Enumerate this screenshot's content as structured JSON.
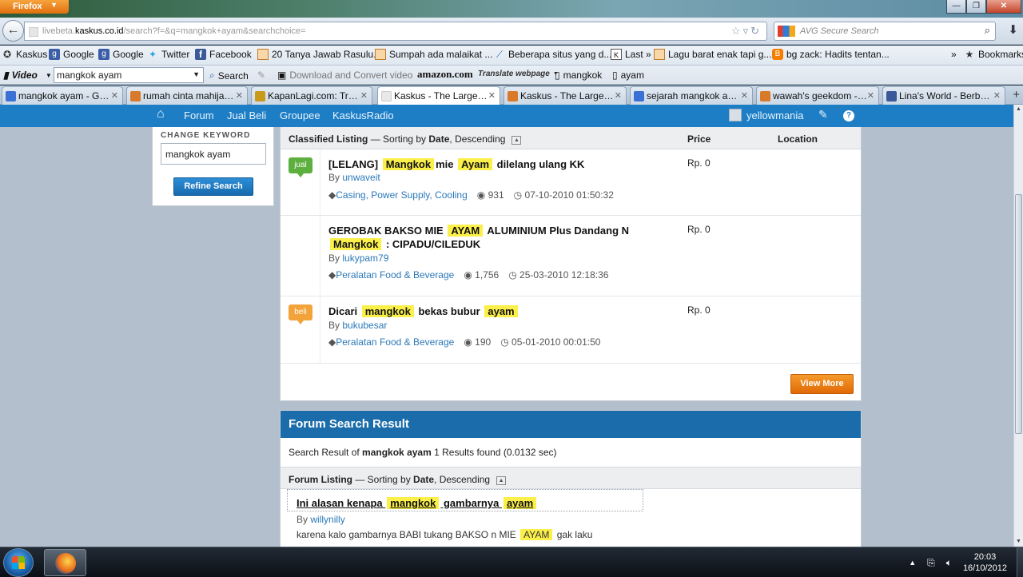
{
  "window": {
    "menu_label": "Firefox",
    "minimize": "—",
    "maximize": "❐",
    "close": "✕"
  },
  "nav": {
    "url_prefix": "livebeta.",
    "url_host": "kaskus.co.id",
    "url_rest": "/search?f=&q=mangkok+ayam&searchchoice=",
    "search_placeholder": "AVG Secure Search"
  },
  "bookmarks": [
    {
      "label": "Kaskus",
      "icon": "star-icon"
    },
    {
      "label": "Google",
      "icon": "google-icon"
    },
    {
      "label": "Google",
      "icon": "google-icon"
    },
    {
      "label": "Twitter",
      "icon": "twitter-icon"
    },
    {
      "label": "Facebook",
      "icon": "facebook-icon"
    },
    {
      "label": "20 Tanya Jawab Rasulu...",
      "icon": "page-icon"
    },
    {
      "label": "Sumpah ada malaikat ...",
      "icon": "page-icon"
    },
    {
      "label": "Beberapa situs yang d...",
      "icon": "feather-icon"
    },
    {
      "label": "Last »",
      "icon": "kaskus-icon"
    },
    {
      "label": "Lagu barat enak tapi g...",
      "icon": "page-icon"
    },
    {
      "label": "bg zack: Hadits tentan...",
      "icon": "blogger-icon"
    },
    {
      "label": "»",
      "icon": "overflow-icon"
    },
    {
      "label": "Bookmarks",
      "icon": "bookmarks-icon"
    }
  ],
  "toolbar": {
    "video_label": "Video",
    "video_query": "mangkok ayam",
    "search_label": "Search",
    "download_label": "Download and Convert video",
    "amazon_label": "amazon.com",
    "translate_label": "Translate webpage",
    "word1": "mangkok",
    "word2": "ayam"
  },
  "tabs": [
    {
      "label": "mangkok ayam - Goo...",
      "color": "#3b70d4",
      "active": false
    },
    {
      "label": "rumah cinta mahija - ...",
      "color": "#d87a2a",
      "active": false
    },
    {
      "label": "KapanLagi.com: Trav...",
      "color": "#c99a1a",
      "active": false
    },
    {
      "label": "Kaskus - The Largest I...",
      "color": "#e8e8e8",
      "active": true
    },
    {
      "label": "Kaskus - The Largest I...",
      "color": "#d87a2a",
      "active": false
    },
    {
      "label": "sejarah mangkok aya...",
      "color": "#3b70d4",
      "active": false
    },
    {
      "label": "wawah's geekdom - ...",
      "color": "#d87a2a",
      "active": false
    },
    {
      "label": "Lina's World - Berbur...",
      "color": "#3b5998",
      "active": false
    }
  ],
  "kaskus_nav": {
    "items": [
      "Forum",
      "Jual Beli",
      "Groupee",
      "KaskusRadio"
    ],
    "username": "yellowmania"
  },
  "sidebar": {
    "title": "CHANGE KEYWORD",
    "keyword": "mangkok ayam",
    "button": "Refine Search"
  },
  "classified": {
    "heading": "Classified Listing",
    "sorting_prefix": " — Sorting by ",
    "sort_field": "Date",
    "sort_dir": ", Descending",
    "price_header": "Price",
    "location_header": "Location",
    "by_label": "By",
    "items": [
      {
        "badge": "jual",
        "title_parts": [
          "[LELANG] ",
          "Mangkok",
          "mie ",
          "Ayam",
          " dilelang ulang KK"
        ],
        "author": "unwaveit",
        "category": "Casing, Power Supply, Cooling",
        "views": "931",
        "date": "07-10-2010 01:50:32",
        "price": "Rp. 0"
      },
      {
        "badge": "",
        "title_parts": [
          "GEROBAK BAKSO MIE ",
          "AYAM",
          " ALUMINIUM Plus Dandang N ",
          "Mangkok",
          " : CIPADU/CILEDUK"
        ],
        "author": "lukypam79",
        "category": "Peralatan Food & Beverage",
        "views": "1,756",
        "date": "25-03-2010 12:18:36",
        "price": "Rp. 0"
      },
      {
        "badge": "beli",
        "title_parts": [
          "Dicari ",
          "mangkok",
          " bekas bubur ",
          "ayam",
          ""
        ],
        "author": "bukubesar",
        "category": "Peralatan Food & Beverage",
        "views": "190",
        "date": "05-01-2010 00:01:50",
        "price": "Rp. 0"
      }
    ],
    "view_more": "View More"
  },
  "forum": {
    "heading": "Forum Search Result",
    "summary_prefix": "Search Result of ",
    "summary_query": "mangkok ayam",
    "summary_suffix": " 1 Results found (0.0132 sec)",
    "list_heading": "Forum Listing",
    "sorting_prefix": " — Sorting by ",
    "sort_field": "Date",
    "sort_dir": ", Descending",
    "result": {
      "title_parts": [
        "Ini alasan kenapa ",
        "mangkok",
        " gambarnya ",
        "ayam",
        ""
      ],
      "by_label": "By",
      "author": "willynilly",
      "snippet_pre": "karena kalo gambarnya BABI tukang BAKSO n MIE ",
      "snippet_hl": "AYAM",
      "snippet_post": " gak laku"
    }
  },
  "taskbar": {
    "time": "20:03",
    "date": "16/10/2012"
  }
}
